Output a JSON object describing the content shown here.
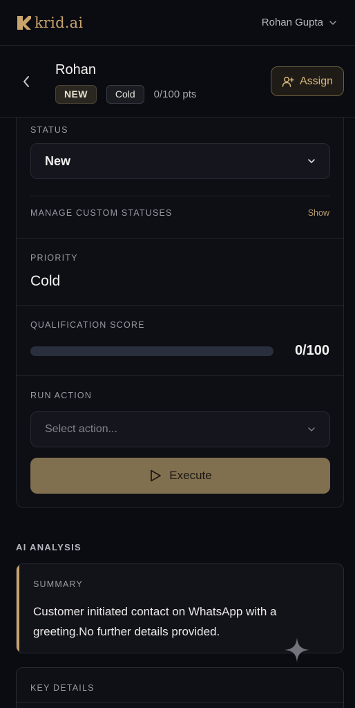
{
  "brand": {
    "name": "krid.ai"
  },
  "user": {
    "name": "Rohan Gupta"
  },
  "lead": {
    "name": "Rohan",
    "status_badge": "NEW",
    "priority_badge": "Cold",
    "points_text": "0/100 pts",
    "assign_label": "Assign"
  },
  "status_section": {
    "label": "STATUS",
    "selected": "New",
    "custom_label": "MANAGE CUSTOM STATUSES",
    "custom_link": "Show"
  },
  "priority_section": {
    "label": "PRIORITY",
    "value": "Cold"
  },
  "score_section": {
    "label": "QUALIFICATION SCORE",
    "value_text": "0/100",
    "progress": 0
  },
  "action_section": {
    "label": "RUN ACTION",
    "placeholder": "Select action...",
    "execute_label": "Execute"
  },
  "ai_analysis": {
    "title": "AI ANALYSIS",
    "summary_label": "SUMMARY",
    "summary_text": "Customer initiated contact on WhatsApp with a greeting.No further details provided.",
    "key_details_label": "KEY DETAILS"
  },
  "colors": {
    "background": "#0b0b12",
    "accent": "#c8a46a",
    "execute_button": "#81704f"
  }
}
